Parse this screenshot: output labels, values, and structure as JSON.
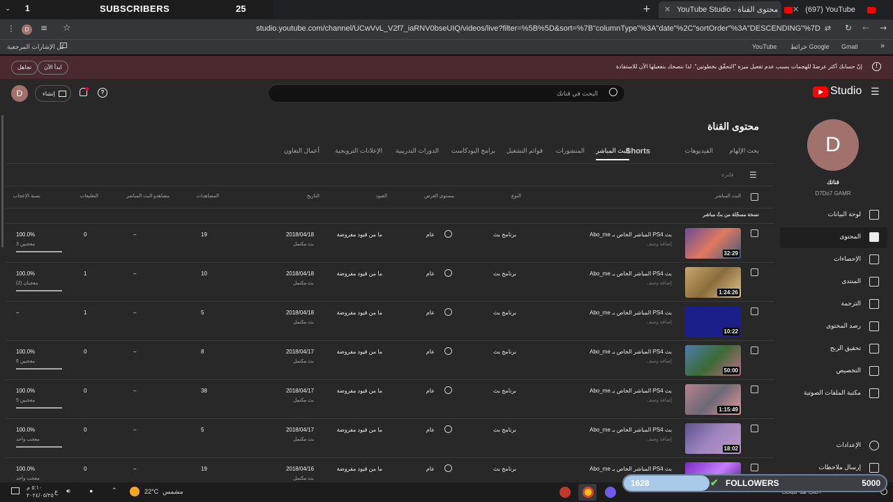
{
  "overlay": {
    "subs_prefix": "1",
    "subs_label": "SUBSCRIBERS",
    "subs_count": "25"
  },
  "browser": {
    "tabs": [
      {
        "title": "YouTube Studio - محتوى القناة",
        "active": true
      },
      {
        "title": "(697) YouTube",
        "active": false
      }
    ],
    "url": "studio.youtube.com/channel/UCwVvL_V2f7_iaRNV0bseUIQ/videos/live?filter=%5B%5D&sort=%7B\"columnType\"%3A\"date\"%2C\"sortOrder\"%3A\"DESCENDING\"%7D",
    "profile_initial": "D",
    "bookmarks": {
      "all": "كل الإشارات المرجعية",
      "items": [
        "YouTube",
        "خرائط Google",
        "Gmail"
      ]
    }
  },
  "banner": {
    "text": "إنّ حسابك أكثر عرضةً للهجمات بسبب عدم تفعيل ميزة \"التحقّق بخطوتين\". لذا ننصحك بتفعيلها الآن للاستفادة من مستوى أمان أعلى.",
    "start_now": "ابدأ الآن",
    "dismiss": "تجاهل"
  },
  "header": {
    "logo": "Studio",
    "search_placeholder": "البحث في قناتك",
    "create_label": "إنشاء",
    "account_initial": "D"
  },
  "sidebar": {
    "avatar_letter": "D",
    "channel_label": "قناتك",
    "channel_name": "D7Do7 GAMR",
    "items": [
      {
        "label": "لوحة البيانات",
        "icon": "dashboard-icon",
        "active": false
      },
      {
        "label": "المحتوى",
        "icon": "content-icon",
        "active": true
      },
      {
        "label": "الإحصاءات",
        "icon": "analytics-icon",
        "active": false
      },
      {
        "label": "المنتدى",
        "icon": "community-icon",
        "active": false
      },
      {
        "label": "الترجمة",
        "icon": "subtitles-icon",
        "active": false
      },
      {
        "label": "رصد المحتوى",
        "icon": "copyright-icon",
        "active": false
      },
      {
        "label": "تحقيق الربح",
        "icon": "monetization-icon",
        "active": false
      },
      {
        "label": "التخصيص",
        "icon": "customization-icon",
        "active": false
      },
      {
        "label": "مكتبة الملفات الصوتية",
        "icon": "audio-library-icon",
        "active": false
      }
    ],
    "settings": "الإعدادات",
    "feedback": "إرسال ملاحظات"
  },
  "main": {
    "title": "محتوى القناة",
    "tabs": [
      "بحث الإلهام",
      "الفيديوهات",
      "Shorts",
      "البث المباشر",
      "المنشورات",
      "قوائم التشغيل",
      "برامج البودكاست",
      "الدورات التدريبية",
      "الإعلانات الترويجية",
      "أعمال التعاون"
    ],
    "active_tab": "البث المباشر",
    "filter_placeholder": "فلترة",
    "columns": [
      "البث المباشر",
      "النوع",
      "مستوى العرض",
      "القيود",
      "التاريخ",
      "المشاهدات",
      "مشاهدو البث المباشر",
      "التعليقات",
      "نسبة الإعجاب"
    ],
    "section": "نسخة مسجّلة من بثّ مباشر",
    "rows": [
      {
        "title": "بث PS4 المباشر الخاص بـ Abo_me",
        "desc": "إضافة وصف",
        "duration": "32:29",
        "type": "برنامج بث",
        "visibility": "عام",
        "restrictions": "ما من قيود مفروضة",
        "date": "2018/04/18",
        "date_sub": "بث مكتمل",
        "views": "19",
        "live_viewers": "–",
        "comments": "0",
        "like_ratio": "100.0%",
        "likes": "3 معجبين",
        "like_fill": 1.0
      },
      {
        "title": "بث PS4 المباشر الخاص بـ Abo_me",
        "desc": "إضافة وصف",
        "duration": "1:24:26",
        "type": "برنامج بث",
        "visibility": "عام",
        "restrictions": "ما من قيود مفروضة",
        "date": "2018/04/18",
        "date_sub": "بث مكتمل",
        "views": "10",
        "live_viewers": "–",
        "comments": "1",
        "like_ratio": "100.0%",
        "likes": "معجبان (2)",
        "like_fill": 1.0
      },
      {
        "title": "بث PS4 المباشر الخاص بـ Abo_me",
        "desc": "إضافة وصف",
        "duration": "10:22",
        "type": "برنامج بث",
        "visibility": "عام",
        "restrictions": "ما من قيود مفروضة",
        "date": "2018/04/18",
        "date_sub": "بث مكتمل",
        "views": "5",
        "live_viewers": "–",
        "comments": "1",
        "like_ratio": "–",
        "likes": "",
        "like_fill": 0
      },
      {
        "title": "بث PS4 المباشر الخاص بـ Abo_me",
        "desc": "إضافة وصف",
        "duration": "50:00",
        "type": "برنامج بث",
        "visibility": "عام",
        "restrictions": "ما من قيود مفروضة",
        "date": "2018/04/17",
        "date_sub": "بث مكتمل",
        "views": "8",
        "live_viewers": "–",
        "comments": "0",
        "like_ratio": "100.0%",
        "likes": "6 معجبين",
        "like_fill": 1.0
      },
      {
        "title": "بث PS4 المباشر الخاص بـ Abo_me",
        "desc": "إضافة وصف",
        "duration": "1:15:49",
        "type": "برنامج بث",
        "visibility": "عام",
        "restrictions": "ما من قيود مفروضة",
        "date": "2018/04/17",
        "date_sub": "بث مكتمل",
        "views": "38",
        "live_viewers": "–",
        "comments": "0",
        "like_ratio": "100.0%",
        "likes": "5 معجبين",
        "like_fill": 1.0
      },
      {
        "title": "بث PS4 المباشر الخاص بـ Abo_me",
        "desc": "إضافة وصف",
        "duration": "18:02",
        "type": "برنامج بث",
        "visibility": "عام",
        "restrictions": "ما من قيود مفروضة",
        "date": "2018/04/17",
        "date_sub": "بث مكتمل",
        "views": "5",
        "live_viewers": "–",
        "comments": "0",
        "like_ratio": "100.0%",
        "likes": "معجب واحد",
        "like_fill": 1.0
      },
      {
        "title": "بث PS4 المباشر الخاص بـ Abo_me",
        "desc": "إضافة وصف",
        "duration": "",
        "type": "برنامج بث",
        "visibility": "عام",
        "restrictions": "ما من قيود مفروضة",
        "date": "2018/04/16",
        "date_sub": "بث مكتمل",
        "views": "19",
        "live_viewers": "–",
        "comments": "0",
        "like_ratio": "100.0%",
        "likes": "معجب واحد",
        "like_fill": 1.0
      }
    ]
  },
  "followers_widget": {
    "current": "1628",
    "label": "FOLLOWERS",
    "goal": "5000",
    "progress": 0.326
  },
  "taskbar": {
    "weather": "22°C",
    "weather_desc": "مشمس",
    "time": "٥:١٠ م",
    "date": "٢٠٢٤/٠٥/٢٥",
    "search": "اكتب هنا للبحث"
  }
}
